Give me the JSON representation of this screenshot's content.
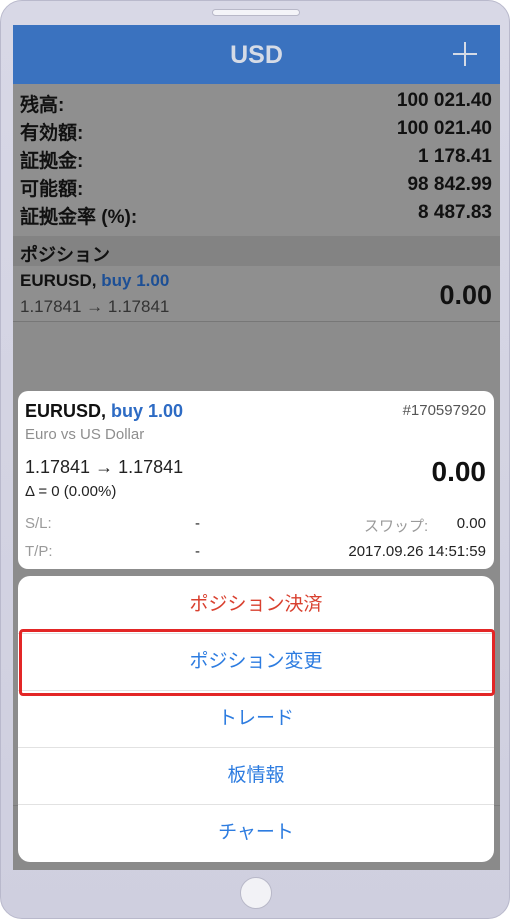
{
  "header": {
    "title": "USD",
    "add_icon": "plus-icon"
  },
  "summary": [
    {
      "label": "残高:",
      "value": "100 021.40"
    },
    {
      "label": "有効額:",
      "value": "100 021.40"
    },
    {
      "label": "証拠金:",
      "value": "1 178.41"
    },
    {
      "label": "可能額:",
      "value": "98 842.99"
    },
    {
      "label": "証拠金率 (%):",
      "value": "8 487.83"
    }
  ],
  "positions_section": {
    "title": "ポジション",
    "row": {
      "symbol": "EURUSD,",
      "type": "buy 1.00",
      "prices": "1.17841 → 1.17841",
      "profit": "0.00"
    }
  },
  "detail": {
    "symbol": "EURUSD,",
    "type": "buy 1.00",
    "ticket": "#170597920",
    "description": "Euro vs US Dollar",
    "prices": "1.17841 → 1.17841",
    "delta": "Δ = 0 (0.00%)",
    "profit": "0.00",
    "sl_label": "S/L:",
    "sl_value": "-",
    "swap_label": "スワップ:",
    "swap_value": "0.00",
    "tp_label": "T/P:",
    "tp_value": "-",
    "time": "2017.09.26 14:51:59"
  },
  "actions": {
    "close_position": "ポジション決済",
    "modify_position": "ポジション変更",
    "trade": "トレード",
    "depth_of_market": "板情報",
    "chart": "チャート"
  },
  "colors": {
    "header_blue": "#3a72bf",
    "action_blue": "#2d7ce0",
    "danger_red": "#d9402f",
    "highlight_red": "#e32626"
  }
}
